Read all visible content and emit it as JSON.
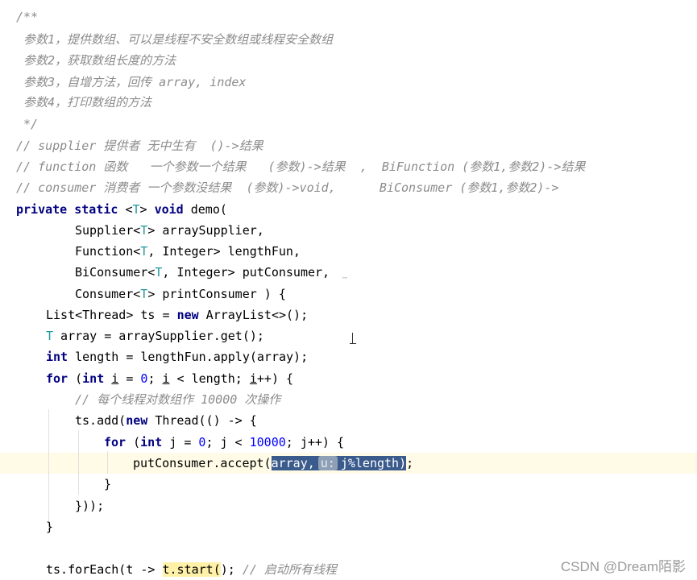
{
  "code": {
    "l1": "/**",
    "l2": " 参数1，提供数组、可以是线程不安全数组或线程安全数组",
    "l3": " 参数2，获取数组长度的方法",
    "l4": " 参数3，自增方法，回传 array, index",
    "l5": " 参数4，打印数组的方法",
    "l6": " */",
    "l7": "// supplier 提供者 无中生有  ()->结果",
    "l8": "// function 函数   一个参数一个结果   (参数)->结果  ,  BiFunction (参数1,参数2)->结果",
    "l9": "// consumer 消费者 一个参数没结果  (参数)->void,      BiConsumer (参数1,参数2)->",
    "l10": {
      "kw1": "private",
      "kw2": "static",
      "lt": " <",
      "t": "T",
      "gt": "> ",
      "kw3": "void",
      "rest": " demo("
    },
    "l11": {
      "a": "Supplier<",
      "t": "T",
      "b": "> arraySupplier,"
    },
    "l12": {
      "a": "Function<",
      "t": "T",
      "b": ", Integer> lengthFun,"
    },
    "l13": {
      "a": "BiConsumer<",
      "t": "T",
      "b": ", Integer> putConsumer,"
    },
    "l14": {
      "a": "Consumer<",
      "t": "T",
      "b": "> printConsumer ) {"
    },
    "l15": {
      "a": "List<Thread> ts = ",
      "kw": "new",
      "b": " ArrayList<>();"
    },
    "l16": {
      "t": "T",
      "b": " array = arraySupplier.get();"
    },
    "l17": {
      "kw": "int",
      "b": " length = lengthFun.apply(array);"
    },
    "l18": {
      "kw1": "for",
      "a": " (",
      "kw2": "int",
      "sp": " ",
      "i1": "i",
      "b": " = ",
      "n": "0",
      "c": "; ",
      "i2": "i",
      "d": " < length; ",
      "i3": "i",
      "e": "++) {"
    },
    "l19": "// 每个线程对数组作 10000 次操作",
    "l20": {
      "a": "ts.add(",
      "kw": "new",
      "b": " Thread(() -> {"
    },
    "l21": {
      "kw1": "for",
      "a": " (",
      "kw2": "int",
      "b": " j = ",
      "n1": "0",
      "c": "; j < ",
      "n2": "10000",
      "d": "; j++) {"
    },
    "l22": {
      "a": "putConsumer.accept(",
      "s1": "array,",
      "hint": "u:",
      "s2": "j%length)",
      "b": ";"
    },
    "l23": "}",
    "l24": "}));",
    "l25": "}",
    "l26": {
      "a": "ts.forEach(t -> ",
      "m": "t.start(",
      "b": "); ",
      "cm": "// 启动所有线程"
    }
  },
  "watermark": "CSDN @Dream陌影",
  "colors": {
    "keyword": "#000080",
    "comment": "#8c8c8c",
    "type_param": "#20999d",
    "number": "#0000ff",
    "selection": "#3a5b8c",
    "current_line": "#fffbe6"
  }
}
